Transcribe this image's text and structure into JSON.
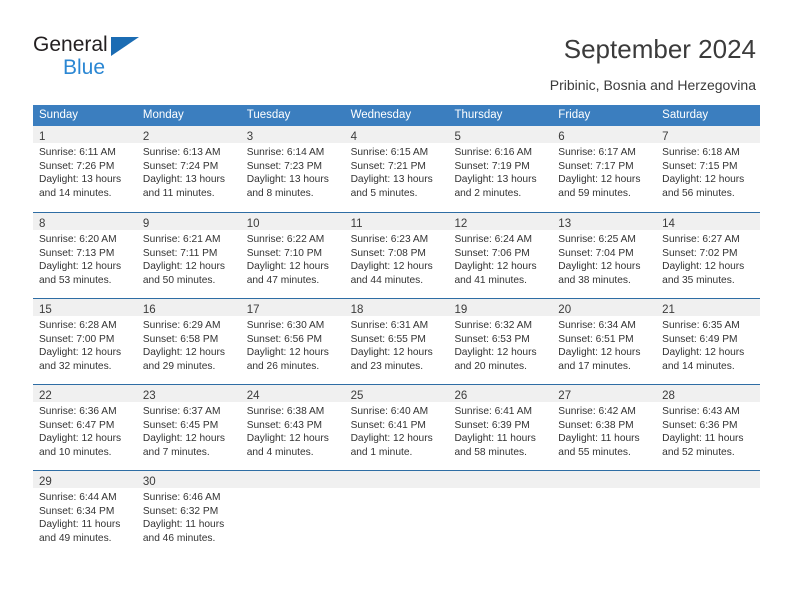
{
  "logo": {
    "text_top": "General",
    "text_bottom": "Blue",
    "triangle_color": "#1b6cb3",
    "blue_color": "#2b87d3"
  },
  "header": {
    "title": "September 2024",
    "subtitle": "Pribinic, Bosnia and Herzegovina"
  },
  "theme": {
    "header_blue": "#3b7ebf",
    "row_divider": "#2e6da4",
    "day_band": "#f0f0f0"
  },
  "weekdays": [
    "Sunday",
    "Monday",
    "Tuesday",
    "Wednesday",
    "Thursday",
    "Friday",
    "Saturday"
  ],
  "weeks": [
    [
      {
        "day": "1",
        "sunrise": "Sunrise: 6:11 AM",
        "sunset": "Sunset: 7:26 PM",
        "daylight1": "Daylight: 13 hours",
        "daylight2": "and 14 minutes."
      },
      {
        "day": "2",
        "sunrise": "Sunrise: 6:13 AM",
        "sunset": "Sunset: 7:24 PM",
        "daylight1": "Daylight: 13 hours",
        "daylight2": "and 11 minutes."
      },
      {
        "day": "3",
        "sunrise": "Sunrise: 6:14 AM",
        "sunset": "Sunset: 7:23 PM",
        "daylight1": "Daylight: 13 hours",
        "daylight2": "and 8 minutes."
      },
      {
        "day": "4",
        "sunrise": "Sunrise: 6:15 AM",
        "sunset": "Sunset: 7:21 PM",
        "daylight1": "Daylight: 13 hours",
        "daylight2": "and 5 minutes."
      },
      {
        "day": "5",
        "sunrise": "Sunrise: 6:16 AM",
        "sunset": "Sunset: 7:19 PM",
        "daylight1": "Daylight: 13 hours",
        "daylight2": "and 2 minutes."
      },
      {
        "day": "6",
        "sunrise": "Sunrise: 6:17 AM",
        "sunset": "Sunset: 7:17 PM",
        "daylight1": "Daylight: 12 hours",
        "daylight2": "and 59 minutes."
      },
      {
        "day": "7",
        "sunrise": "Sunrise: 6:18 AM",
        "sunset": "Sunset: 7:15 PM",
        "daylight1": "Daylight: 12 hours",
        "daylight2": "and 56 minutes."
      }
    ],
    [
      {
        "day": "8",
        "sunrise": "Sunrise: 6:20 AM",
        "sunset": "Sunset: 7:13 PM",
        "daylight1": "Daylight: 12 hours",
        "daylight2": "and 53 minutes."
      },
      {
        "day": "9",
        "sunrise": "Sunrise: 6:21 AM",
        "sunset": "Sunset: 7:11 PM",
        "daylight1": "Daylight: 12 hours",
        "daylight2": "and 50 minutes."
      },
      {
        "day": "10",
        "sunrise": "Sunrise: 6:22 AM",
        "sunset": "Sunset: 7:10 PM",
        "daylight1": "Daylight: 12 hours",
        "daylight2": "and 47 minutes."
      },
      {
        "day": "11",
        "sunrise": "Sunrise: 6:23 AM",
        "sunset": "Sunset: 7:08 PM",
        "daylight1": "Daylight: 12 hours",
        "daylight2": "and 44 minutes."
      },
      {
        "day": "12",
        "sunrise": "Sunrise: 6:24 AM",
        "sunset": "Sunset: 7:06 PM",
        "daylight1": "Daylight: 12 hours",
        "daylight2": "and 41 minutes."
      },
      {
        "day": "13",
        "sunrise": "Sunrise: 6:25 AM",
        "sunset": "Sunset: 7:04 PM",
        "daylight1": "Daylight: 12 hours",
        "daylight2": "and 38 minutes."
      },
      {
        "day": "14",
        "sunrise": "Sunrise: 6:27 AM",
        "sunset": "Sunset: 7:02 PM",
        "daylight1": "Daylight: 12 hours",
        "daylight2": "and 35 minutes."
      }
    ],
    [
      {
        "day": "15",
        "sunrise": "Sunrise: 6:28 AM",
        "sunset": "Sunset: 7:00 PM",
        "daylight1": "Daylight: 12 hours",
        "daylight2": "and 32 minutes."
      },
      {
        "day": "16",
        "sunrise": "Sunrise: 6:29 AM",
        "sunset": "Sunset: 6:58 PM",
        "daylight1": "Daylight: 12 hours",
        "daylight2": "and 29 minutes."
      },
      {
        "day": "17",
        "sunrise": "Sunrise: 6:30 AM",
        "sunset": "Sunset: 6:56 PM",
        "daylight1": "Daylight: 12 hours",
        "daylight2": "and 26 minutes."
      },
      {
        "day": "18",
        "sunrise": "Sunrise: 6:31 AM",
        "sunset": "Sunset: 6:55 PM",
        "daylight1": "Daylight: 12 hours",
        "daylight2": "and 23 minutes."
      },
      {
        "day": "19",
        "sunrise": "Sunrise: 6:32 AM",
        "sunset": "Sunset: 6:53 PM",
        "daylight1": "Daylight: 12 hours",
        "daylight2": "and 20 minutes."
      },
      {
        "day": "20",
        "sunrise": "Sunrise: 6:34 AM",
        "sunset": "Sunset: 6:51 PM",
        "daylight1": "Daylight: 12 hours",
        "daylight2": "and 17 minutes."
      },
      {
        "day": "21",
        "sunrise": "Sunrise: 6:35 AM",
        "sunset": "Sunset: 6:49 PM",
        "daylight1": "Daylight: 12 hours",
        "daylight2": "and 14 minutes."
      }
    ],
    [
      {
        "day": "22",
        "sunrise": "Sunrise: 6:36 AM",
        "sunset": "Sunset: 6:47 PM",
        "daylight1": "Daylight: 12 hours",
        "daylight2": "and 10 minutes."
      },
      {
        "day": "23",
        "sunrise": "Sunrise: 6:37 AM",
        "sunset": "Sunset: 6:45 PM",
        "daylight1": "Daylight: 12 hours",
        "daylight2": "and 7 minutes."
      },
      {
        "day": "24",
        "sunrise": "Sunrise: 6:38 AM",
        "sunset": "Sunset: 6:43 PM",
        "daylight1": "Daylight: 12 hours",
        "daylight2": "and 4 minutes."
      },
      {
        "day": "25",
        "sunrise": "Sunrise: 6:40 AM",
        "sunset": "Sunset: 6:41 PM",
        "daylight1": "Daylight: 12 hours",
        "daylight2": "and 1 minute."
      },
      {
        "day": "26",
        "sunrise": "Sunrise: 6:41 AM",
        "sunset": "Sunset: 6:39 PM",
        "daylight1": "Daylight: 11 hours",
        "daylight2": "and 58 minutes."
      },
      {
        "day": "27",
        "sunrise": "Sunrise: 6:42 AM",
        "sunset": "Sunset: 6:38 PM",
        "daylight1": "Daylight: 11 hours",
        "daylight2": "and 55 minutes."
      },
      {
        "day": "28",
        "sunrise": "Sunrise: 6:43 AM",
        "sunset": "Sunset: 6:36 PM",
        "daylight1": "Daylight: 11 hours",
        "daylight2": "and 52 minutes."
      }
    ],
    [
      {
        "day": "29",
        "sunrise": "Sunrise: 6:44 AM",
        "sunset": "Sunset: 6:34 PM",
        "daylight1": "Daylight: 11 hours",
        "daylight2": "and 49 minutes."
      },
      {
        "day": "30",
        "sunrise": "Sunrise: 6:46 AM",
        "sunset": "Sunset: 6:32 PM",
        "daylight1": "Daylight: 11 hours",
        "daylight2": "and 46 minutes."
      },
      {
        "day": "",
        "sunrise": "",
        "sunset": "",
        "daylight1": "",
        "daylight2": ""
      },
      {
        "day": "",
        "sunrise": "",
        "sunset": "",
        "daylight1": "",
        "daylight2": ""
      },
      {
        "day": "",
        "sunrise": "",
        "sunset": "",
        "daylight1": "",
        "daylight2": ""
      },
      {
        "day": "",
        "sunrise": "",
        "sunset": "",
        "daylight1": "",
        "daylight2": ""
      },
      {
        "day": "",
        "sunrise": "",
        "sunset": "",
        "daylight1": "",
        "daylight2": ""
      }
    ]
  ]
}
